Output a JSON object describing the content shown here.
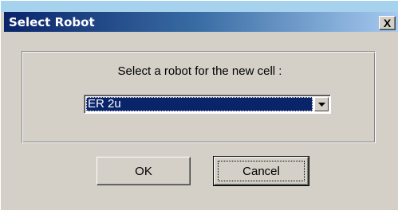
{
  "dialog": {
    "title": "Select Robot",
    "close_glyph": "X",
    "prompt": "Select a robot for the new cell :",
    "robot_select": {
      "selected": "ER 2u",
      "arrow_icon": "chevron-down-icon"
    },
    "ok_label": "OK",
    "cancel_label": "Cancel"
  },
  "colors": {
    "title_bar_start": "#0a246a",
    "title_bar_end": "#a6caf0",
    "face": "#d4d0c8",
    "selection": "#0a246a"
  }
}
